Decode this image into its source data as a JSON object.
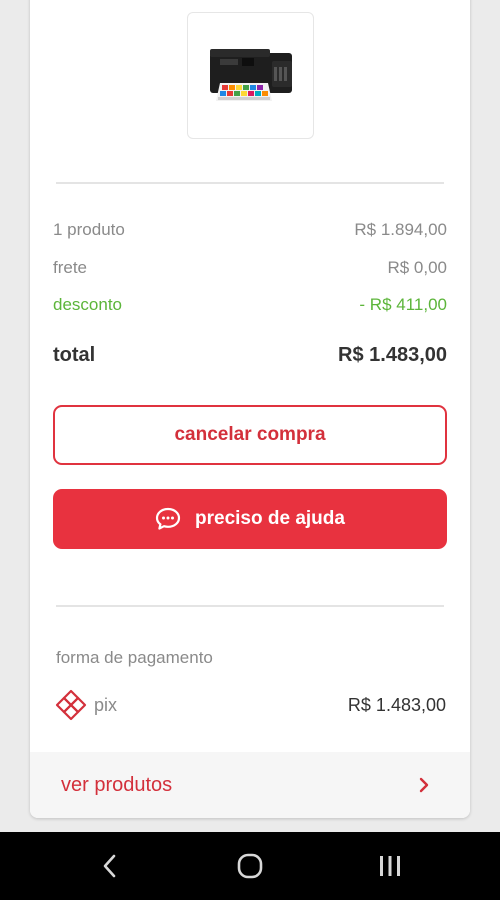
{
  "order": {
    "product_image": "printer-image"
  },
  "summary": {
    "products_label": "1 produto",
    "products_value": "R$ 1.894,00",
    "shipping_label": "frete",
    "shipping_value": "R$ 0,00",
    "discount_label": "desconto",
    "discount_value": "- R$ 411,00",
    "total_label": "total",
    "total_value": "R$ 1.483,00"
  },
  "actions": {
    "cancel_label": "cancelar compra",
    "help_label": "preciso de ajuda",
    "help_icon": "chat-bubble-icon"
  },
  "payment": {
    "section_label": "forma de pagamento",
    "method_icon": "pix-icon",
    "method_name": "pix",
    "amount": "R$ 1.483,00"
  },
  "footer": {
    "link_label": "ver produtos",
    "link_icon": "chevron-right-icon"
  },
  "system_nav": {
    "icons": [
      "back-icon",
      "home-icon",
      "recents-icon"
    ]
  },
  "colors": {
    "brand_red": "#e8323f",
    "discount_green": "#5cb53a",
    "muted_text": "#8a8a8a",
    "dark_text": "#333333"
  }
}
